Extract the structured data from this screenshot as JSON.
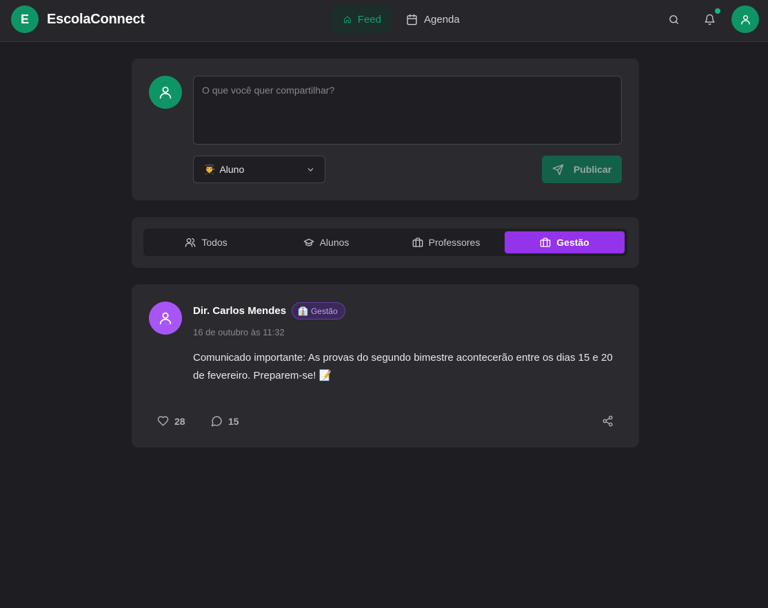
{
  "header": {
    "logo_letter": "E",
    "app_name": "EscolaConnect",
    "nav": [
      {
        "label": "Feed",
        "icon": "home-icon",
        "active": true
      },
      {
        "label": "Agenda",
        "icon": "calendar-icon",
        "active": false
      }
    ],
    "accent_color": "#10a372"
  },
  "composer": {
    "placeholder": "O que você quer compartilhar?",
    "value": "",
    "role_select": {
      "emoji": "👨‍🎓",
      "selected": "Aluno"
    },
    "publish_label": "Publicar"
  },
  "filters": {
    "tabs": [
      {
        "label": "Todos",
        "icon": "users-icon",
        "active": false
      },
      {
        "label": "Alunos",
        "icon": "graduation-cap-icon",
        "active": false
      },
      {
        "label": "Professores",
        "icon": "briefcase-icon",
        "active": false
      },
      {
        "label": "Gestão",
        "icon": "briefcase-icon",
        "active": true
      }
    ],
    "active_color": "#9333ea"
  },
  "posts": [
    {
      "author": "Dir. Carlos Mendes",
      "badge_emoji": "👔",
      "badge": "Gestão",
      "time": "16 de outubro às 11:32",
      "content": "Comunicado importante: As provas do segundo bimestre acontecerão entre os dias 15 e 20 de fevereiro. Preparem-se! 📝",
      "likes": "28",
      "comments": "15",
      "avatar_color": "#a855f7"
    }
  ]
}
